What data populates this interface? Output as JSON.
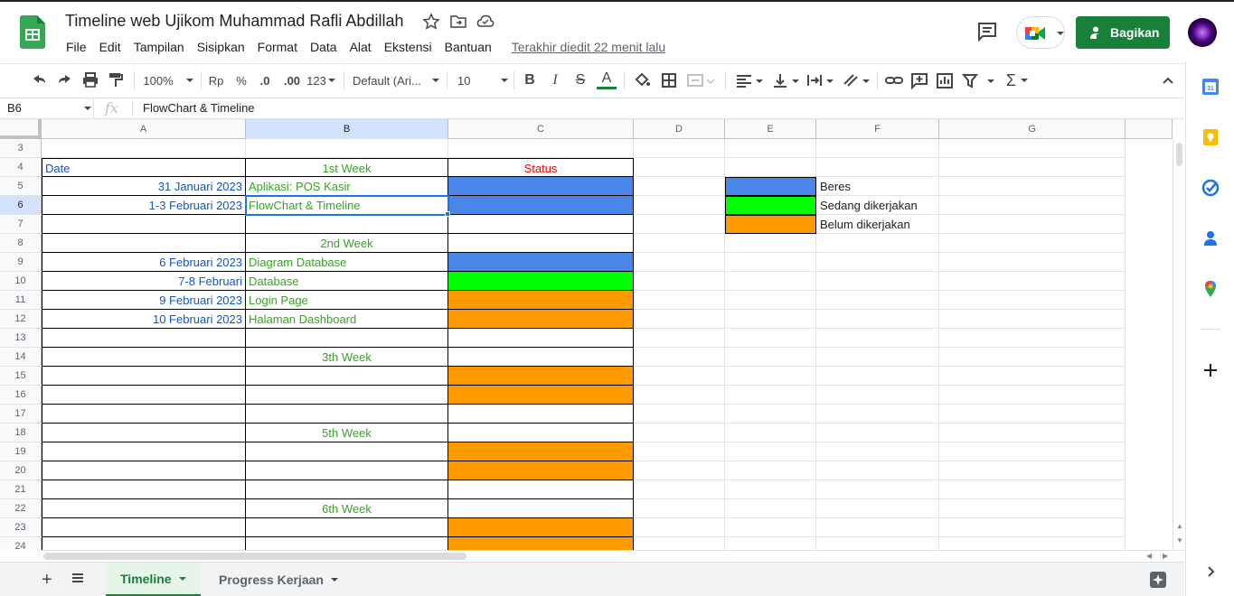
{
  "header": {
    "title": "Timeline web Ujikom Muhammad Rafli Abdillah",
    "menus": [
      "File",
      "Edit",
      "Tampilan",
      "Sisipkan",
      "Format",
      "Data",
      "Alat",
      "Ekstensi",
      "Bantuan"
    ],
    "last_edit": "Terakhir diedit 22 menit lalu",
    "share_label": "Bagikan"
  },
  "toolbar": {
    "zoom": "100%",
    "currency": "Rp",
    "percent": "%",
    "dec_decrease": ".0",
    "dec_increase": ".00",
    "more_formats": "123",
    "font": "Default (Ari...",
    "font_size": "10",
    "bold": "B",
    "italic": "I",
    "strike": "S",
    "text_color": "A",
    "functions": "Σ"
  },
  "formula_bar": {
    "cell_ref": "B6",
    "fx": "fx",
    "value": "FlowChart & Timeline"
  },
  "columns": [
    "A",
    "B",
    "C",
    "D",
    "E",
    "F",
    "G"
  ],
  "selected_column": "B",
  "selected_row": "6",
  "rows": [
    {
      "n": "3",
      "a": "",
      "b": "",
      "c": ""
    },
    {
      "n": "4",
      "a": "Date",
      "b": "1st Week",
      "c": "Status"
    },
    {
      "n": "5",
      "a": "31 Januari 2023",
      "b": "Aplikasi: POS Kasir",
      "c": "",
      "status": "blue"
    },
    {
      "n": "6",
      "a": "1-3 Februari 2023",
      "b": "FlowChart & Timeline",
      "c": "",
      "status": "blue"
    },
    {
      "n": "7",
      "a": "",
      "b": "",
      "c": ""
    },
    {
      "n": "8",
      "a": "",
      "b": "2nd Week",
      "c": ""
    },
    {
      "n": "9",
      "a": "6 Februari 2023",
      "b": "Diagram Database",
      "c": "",
      "status": "blue"
    },
    {
      "n": "10",
      "a": "7-8 Februari",
      "b": "Database",
      "c": "",
      "status": "green"
    },
    {
      "n": "11",
      "a": "9 Februari 2023",
      "b": "Login Page",
      "c": "",
      "status": "orange"
    },
    {
      "n": "12",
      "a": "10 Februari 2023",
      "b": "Halaman Dashboard",
      "c": "",
      "status": "orange"
    },
    {
      "n": "13",
      "a": "",
      "b": "",
      "c": ""
    },
    {
      "n": "14",
      "a": "",
      "b": "3th Week",
      "c": ""
    },
    {
      "n": "15",
      "a": "",
      "b": "",
      "c": "",
      "status": "orange"
    },
    {
      "n": "16",
      "a": "",
      "b": "",
      "c": "",
      "status": "orange"
    },
    {
      "n": "17",
      "a": "",
      "b": "",
      "c": ""
    },
    {
      "n": "18",
      "a": "",
      "b": "5th Week",
      "c": ""
    },
    {
      "n": "19",
      "a": "",
      "b": "",
      "c": "",
      "status": "orange"
    },
    {
      "n": "20",
      "a": "",
      "b": "",
      "c": "",
      "status": "orange"
    },
    {
      "n": "21",
      "a": "",
      "b": "",
      "c": ""
    },
    {
      "n": "22",
      "a": "",
      "b": "6th Week",
      "c": ""
    },
    {
      "n": "23",
      "a": "",
      "b": "",
      "c": "",
      "status": "orange"
    },
    {
      "n": "24",
      "a": "",
      "b": "",
      "c": "",
      "status": "orange"
    }
  ],
  "legend": [
    {
      "label": "Beres",
      "color": "#4a86e8"
    },
    {
      "label": "Sedang dikerjakan",
      "color": "#00ff00"
    },
    {
      "label": "Belum dikerjakan",
      "color": "#ff9900"
    }
  ],
  "status_colors": {
    "blue": "#4a86e8",
    "green": "#00ff00",
    "orange": "#ff9900"
  },
  "tabs": [
    {
      "label": "Timeline",
      "active": true
    },
    {
      "label": "Progress Kerjaan",
      "active": false
    }
  ],
  "add_sheet": "+"
}
